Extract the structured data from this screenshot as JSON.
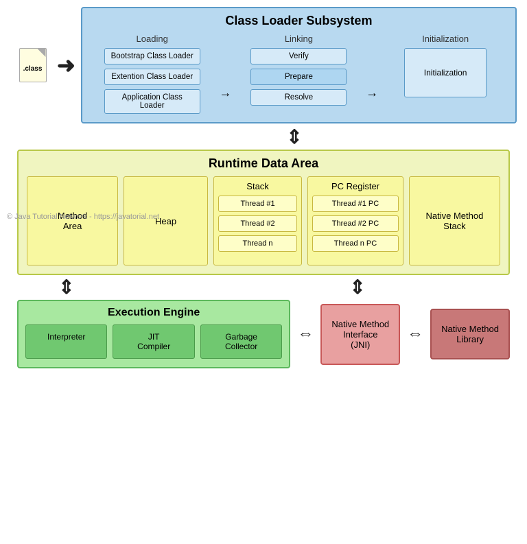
{
  "classLoader": {
    "title": "Class Loader Subsystem",
    "loading": {
      "label": "Loading",
      "items": [
        "Bootstrap Class Loader",
        "Extention Class Loader",
        "Application Class Loader"
      ]
    },
    "linking": {
      "label": "Linking",
      "items": [
        "Verify",
        "Prepare",
        "Resolve"
      ]
    },
    "initialization": {
      "label": "Initialization",
      "item": "Initialization"
    }
  },
  "classFile": {
    "label": ".class"
  },
  "watermark": "© Java Tutorial Network - https://javatorial.net",
  "runtimeDataArea": {
    "title": "Runtime Data Area",
    "methodArea": "Method\nArea",
    "heap": "Heap",
    "stack": {
      "title": "Stack",
      "threads": [
        "Thread #1",
        "Thread #2",
        "Thread n"
      ]
    },
    "pcRegister": {
      "title": "PC Register",
      "threads": [
        "Thread #1 PC",
        "Thread #2 PC",
        "Thread n PC"
      ]
    },
    "nativeMethodStack": "Native Method\nStack"
  },
  "executionEngine": {
    "title": "Execution Engine",
    "interpreter": "Interpreter",
    "jitCompiler": "JIT\nCompiler",
    "garbageCollector": "Garbage\nCollector"
  },
  "nativeMethodInterface": "Native Method\nInterface\n(JNI)",
  "nativeMethodLibrary": "Native Method\nLibrary"
}
